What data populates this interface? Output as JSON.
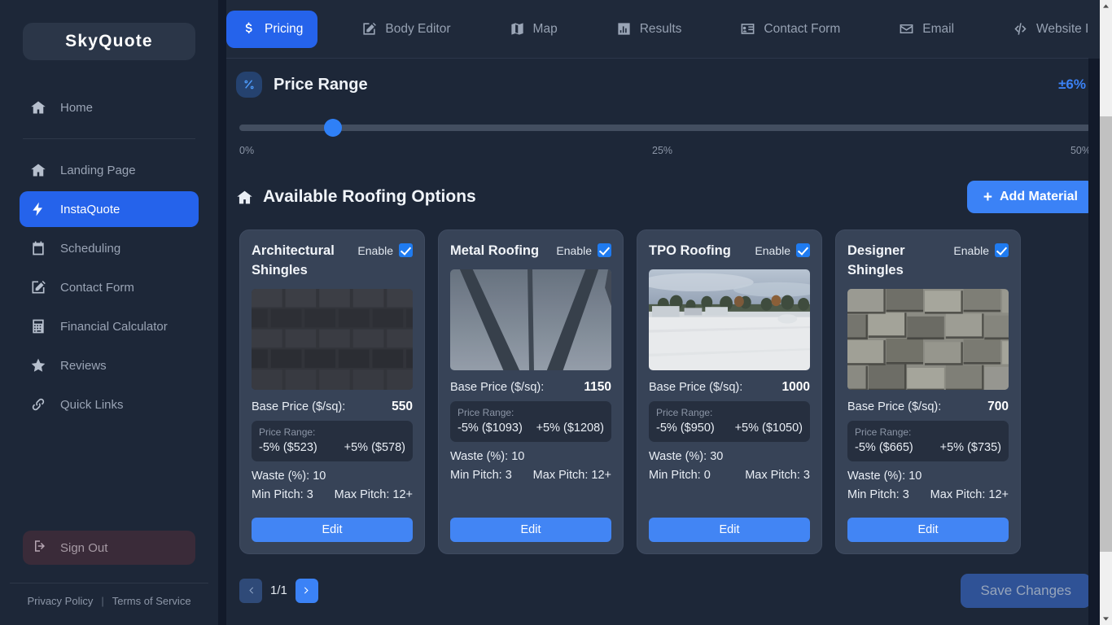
{
  "brand": {
    "name": "SkyQuote"
  },
  "sidebar": {
    "home": {
      "label": "Home",
      "icon": "home-icon"
    },
    "items": [
      {
        "label": "Landing Page",
        "icon": "home-icon",
        "active": false
      },
      {
        "label": "InstaQuote",
        "icon": "bolt-icon",
        "active": true
      },
      {
        "label": "Scheduling",
        "icon": "calendar-icon",
        "active": false
      },
      {
        "label": "Contact Form",
        "icon": "edit-square-icon",
        "active": false
      },
      {
        "label": "Financial Calculator",
        "icon": "calculator-icon",
        "active": false
      },
      {
        "label": "Reviews",
        "icon": "star-icon",
        "active": false
      },
      {
        "label": "Quick Links",
        "icon": "link-icon",
        "active": false
      }
    ],
    "sign_out": {
      "label": "Sign Out",
      "icon": "sign-out-icon"
    },
    "footer": {
      "privacy": "Privacy Policy",
      "divider": "|",
      "terms": "Terms of Service"
    }
  },
  "tabs": [
    {
      "label": "Pricing",
      "icon": "dollar-icon",
      "active": true
    },
    {
      "label": "Body Editor",
      "icon": "edit-square-icon",
      "active": false
    },
    {
      "label": "Map",
      "icon": "map-icon",
      "active": false
    },
    {
      "label": "Results",
      "icon": "chart-bar-icon",
      "active": false
    },
    {
      "label": "Contact Form",
      "icon": "id-card-icon",
      "active": false
    },
    {
      "label": "Email",
      "icon": "envelope-icon",
      "active": false
    },
    {
      "label": "Website Inte",
      "icon": "code-icon",
      "active": false
    }
  ],
  "price_range": {
    "icon": "percent-icon",
    "title": "Price Range",
    "value": "±6%",
    "slider_percent": 11,
    "ticks": {
      "min": "0%",
      "mid": "25%",
      "max": "50%"
    }
  },
  "options": {
    "icon": "home-icon",
    "title": "Available Roofing Options",
    "add_button": {
      "plus": "+",
      "label": "Add Material"
    },
    "labels": {
      "enable": "Enable",
      "base_price": "Base Price ($/sq):",
      "price_range": "Price Range:",
      "waste": "Waste (%):",
      "min_pitch": "Min Pitch:",
      "max_pitch": "Max Pitch:",
      "edit": "Edit"
    },
    "materials": [
      {
        "name": "Architectural Shingles",
        "enabled": true,
        "thumb": "architectural-shingles-photo",
        "base_price": "550",
        "range_low": "-5% ($523)",
        "range_high": "+5% ($578)",
        "waste": "10",
        "min_pitch": "3",
        "max_pitch": "12+"
      },
      {
        "name": "Metal Roofing",
        "enabled": true,
        "thumb": "metal-roofing-photo",
        "base_price": "1150",
        "range_low": "-5% ($1093)",
        "range_high": "+5% ($1208)",
        "waste": "10",
        "min_pitch": "3",
        "max_pitch": "12+"
      },
      {
        "name": "TPO Roofing",
        "enabled": true,
        "thumb": "tpo-roofing-photo",
        "base_price": "1000",
        "range_low": "-5% ($950)",
        "range_high": "+5% ($1050)",
        "waste": "30",
        "min_pitch": "0",
        "max_pitch": "3"
      },
      {
        "name": "Designer Shingles",
        "enabled": true,
        "thumb": "designer-shingles-photo",
        "base_price": "700",
        "range_low": "-5% ($665)",
        "range_high": "+5% ($735)",
        "waste": "10",
        "min_pitch": "3",
        "max_pitch": "12+"
      }
    ]
  },
  "pagination": {
    "page_label": "1/1"
  },
  "save": {
    "label": "Save Changes",
    "disabled": true
  },
  "colors": {
    "accent_blue": "#3b82f6",
    "app_bg": "#1d2738",
    "card_bg": "#374357",
    "range_box_bg": "#262f3f",
    "sign_out_bg": "#3a2b39"
  }
}
